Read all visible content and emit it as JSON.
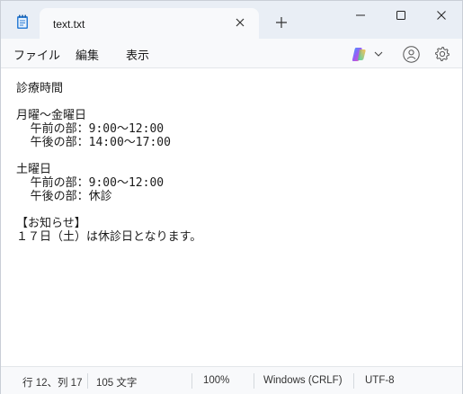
{
  "tab": {
    "title": "text.txt"
  },
  "menu": {
    "file": "ファイル",
    "edit": "編集",
    "view": "表示"
  },
  "toolbar_icons": [
    "copilot-icon",
    "chevron-down-icon",
    "account-icon",
    "gear-icon"
  ],
  "document": {
    "text": "診療時間\n\n月曜～金曜日\n  午前の部：9:00～12:00\n  午後の部：14:00～17:00\n\n土曜日\n  午前の部：9:00～12:00\n  午後の部：休診\n\n【お知らせ】\n１７日（土）は休診日となります。"
  },
  "status": {
    "position": "行 12、列 17",
    "chars": "105 文字",
    "zoom": "100%",
    "line_ending": "Windows (CRLF)",
    "encoding": "UTF-8"
  },
  "colors": {
    "titlebar": "#e9eef5",
    "menubar": "#f8f9fb",
    "notepad_icon": "#2f7fd6"
  }
}
